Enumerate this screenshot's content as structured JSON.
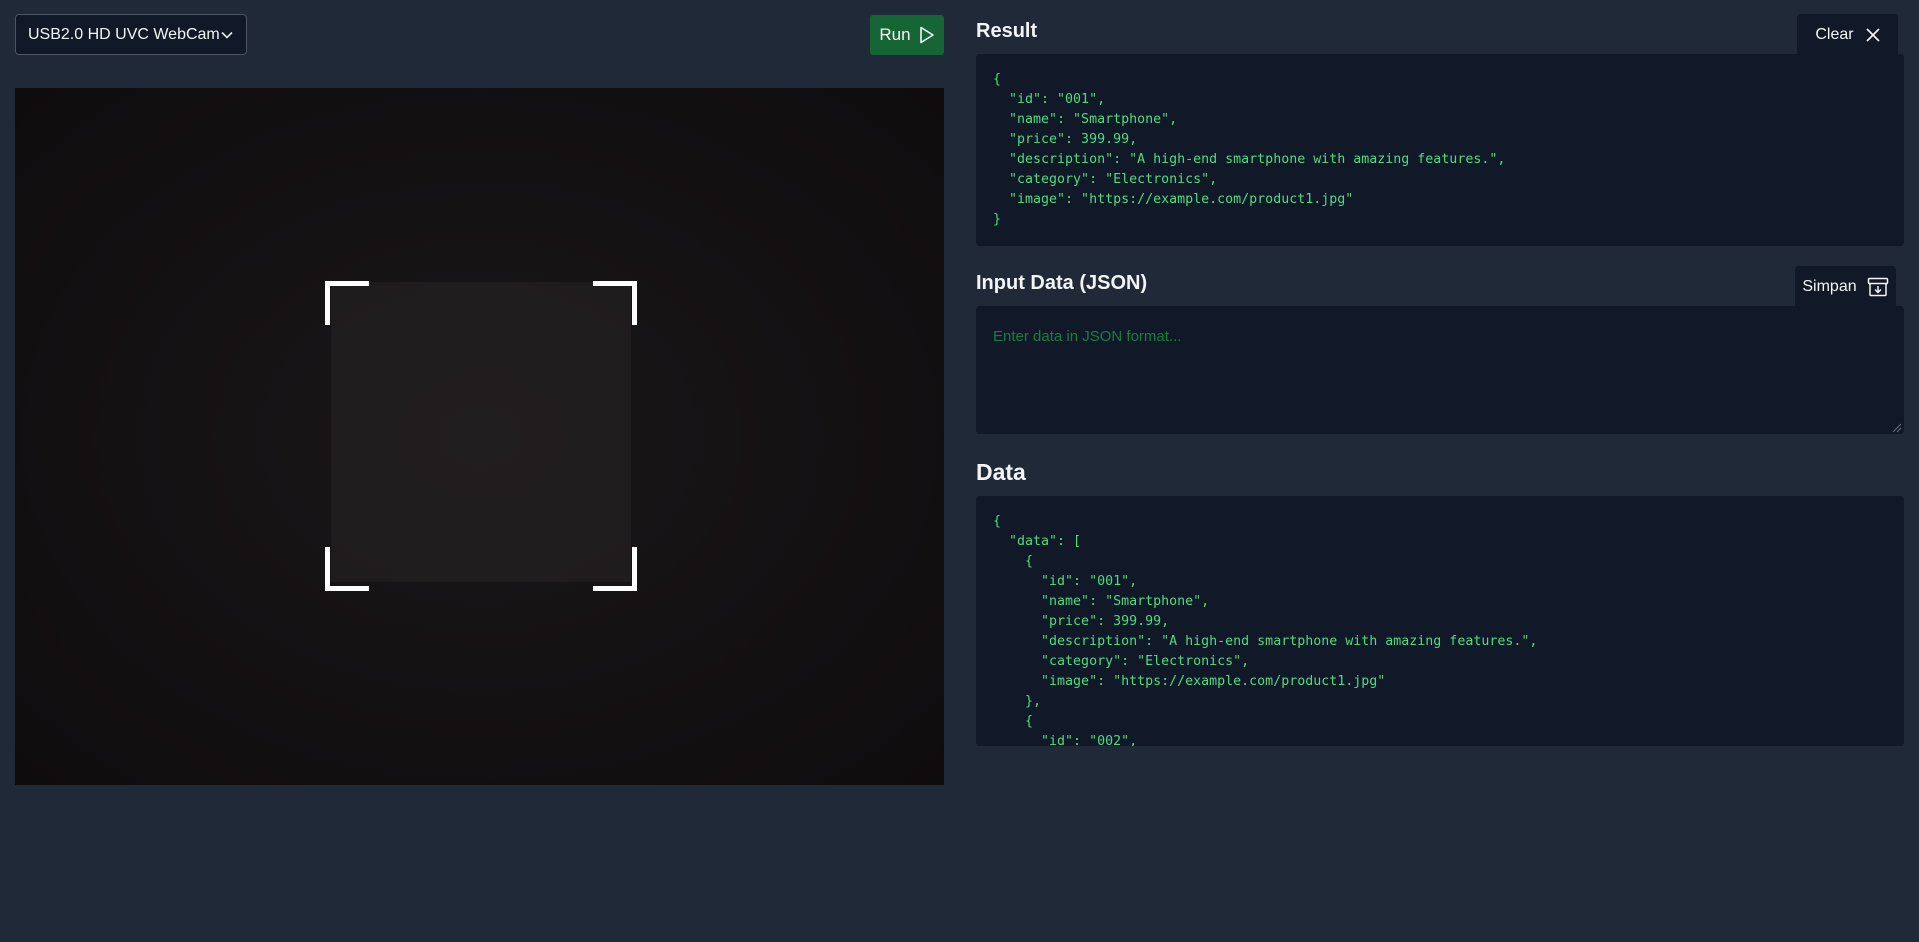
{
  "camera": {
    "selected": "USB2.0 HD UVC WebCam",
    "icon": "chevron-down-icon"
  },
  "run_button": {
    "label": "Run",
    "icon": "play-icon"
  },
  "result": {
    "title": "Result",
    "clear_label": "Clear",
    "clear_icon": "close-icon",
    "json": "{\n  \"id\": \"001\",\n  \"name\": \"Smartphone\",\n  \"price\": 399.99,\n  \"description\": \"A high-end smartphone with amazing features.\",\n  \"category\": \"Electronics\",\n  \"image\": \"https://example.com/product1.jpg\"\n}"
  },
  "input": {
    "title": "Input Data (JSON)",
    "save_label": "Simpan",
    "save_icon": "archive-download-icon",
    "placeholder": "Enter data in JSON format..."
  },
  "data": {
    "title": "Data",
    "json": "{\n  \"data\": [\n    {\n      \"id\": \"001\",\n      \"name\": \"Smartphone\",\n      \"price\": 399.99,\n      \"description\": \"A high-end smartphone with amazing features.\",\n      \"category\": \"Electronics\",\n      \"image\": \"https://example.com/product1.jpg\"\n    },\n    {\n      \"id\": \"002\","
  },
  "colors": {
    "background": "#1f2937",
    "panel": "#111827",
    "code_text": "#4ade80",
    "run_button": "#166534"
  }
}
